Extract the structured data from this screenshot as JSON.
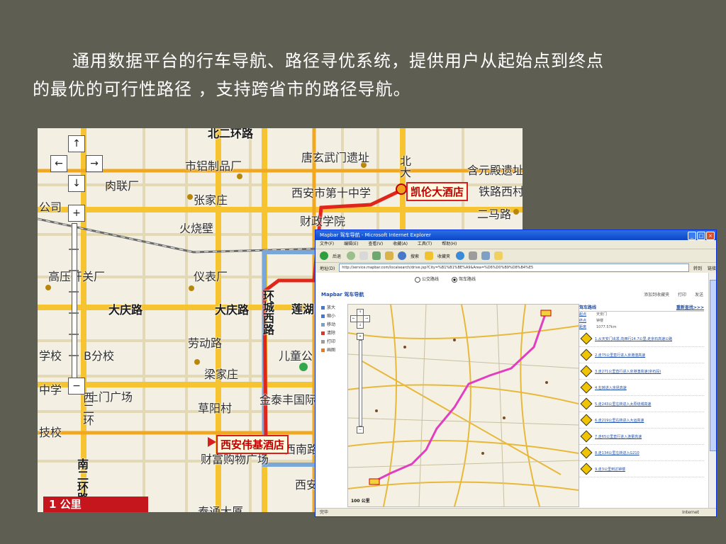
{
  "intro": {
    "line1": "通用数据平台的行车导航、路径寻优系统，提供用户从起始点到终点",
    "line2": "的最优的可行性路径 ，支持跨省市的路径导航。"
  },
  "city_map": {
    "labels": {
      "beihuanroad": "北二环路",
      "shilv": "市铝制品厂",
      "tangxuanwu": "唐玄武门遗址",
      "hehuan": "含元殿遗址",
      "roulian": "肉联厂",
      "gongsi": "公司",
      "zhangjia": "张家庄",
      "xiandi10": "西安市第十中学",
      "tielu": "铁路西村",
      "caizheng": "财政学院",
      "huoshao": "火烧壁",
      "erma": "二马路",
      "gaoya": "高压开关厂",
      "yibiao": "仪表厂",
      "daqing1": "大庆路",
      "daqing2": "大庆路",
      "lianhu": "莲湖",
      "huancheng": "环城西路",
      "laodong": "劳动路",
      "ertong": "儿童公",
      "xuexiao": "学校",
      "bifen": "B分校",
      "liangjia": "梁家庄",
      "zhongxue": "中学",
      "tumen": "土门广场",
      "jintai": "金泰丰国际",
      "caoyang": "草阳村",
      "xiercuan": "西二环",
      "jishu": "技校",
      "xinan": "西南路",
      "nanerhuan": "南二环路",
      "xian2": "西安",
      "dasha": "大厦",
      "taitong": "泰通大厦",
      "caifu": "财富购物广场",
      "bei": "北大"
    },
    "poi_start": "凯伦大酒店",
    "poi_end": "西安伟基酒店",
    "nav_controls": [
      "↑",
      "←",
      "→",
      "↓",
      "+",
      "−"
    ],
    "scale": "1 公里"
  },
  "ie_window": {
    "title": "Mapbar 驾车导航 - Microsoft Internet Explorer",
    "menus": [
      "文件(F)",
      "编辑(E)",
      "查看(V)",
      "收藏(A)",
      "工具(T)",
      "帮助(H)"
    ],
    "toolbar": {
      "back": "后退",
      "search": "搜索",
      "favorites": "收藏夹"
    },
    "address_label": "地址(D)",
    "address_value": "http://service.mapbar.com/localsearch/drive.jsp?City=%B1%B1%BE%A9&Area=%D6%D0%B9%D8%B4%E5",
    "go_label": "转到",
    "links_label": "链接",
    "route_options": [
      "公交路线",
      "驾车路线"
    ],
    "logo": "Mapbar 驾车导航",
    "tools": [
      "放大",
      "缩小",
      "移动",
      "清除",
      "打印",
      "画图"
    ],
    "top_links": [
      "添加到收藏夹",
      "打印",
      "发送"
    ],
    "scale": "100 公里",
    "panel": {
      "title": "驾车路线",
      "link": "重新查找>>>",
      "from_label": "起点",
      "from_value": "天安门",
      "to_label": "终点",
      "to_value": "钟楼",
      "distance_label": "距离",
      "distance_value": "1077.57km"
    },
    "steps": [
      "1.从天安门出发,向西行14.7公里,走京石高速公路",
      "2.走75公里直行进入京港澳高速",
      "3.走271公里直行进入京港澳高速(京石段)",
      "4.右转进入京昆高速",
      "5.走243公里左转进入太原绕城高速",
      "6.走219公里右转进入大运高速",
      "7.走65公里直行进入连霍高速",
      "8.走134公里左转进入G210",
      "9.走3公里到达钟楼"
    ],
    "status": "完毕",
    "status_right": "Internet"
  }
}
